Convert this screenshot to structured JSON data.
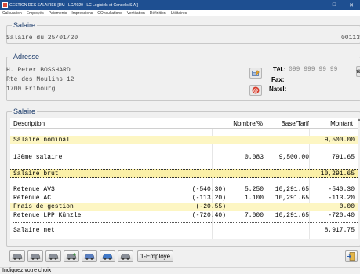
{
  "window": {
    "title": "GESTION DES SALAIRES [DM - LC/2020 - LC Logiciels et Conseils S.A.]",
    "min": "–",
    "max": "□",
    "close": "✕"
  },
  "menu": [
    "Calculation",
    "Employés",
    "Paiements",
    "Impressions",
    "COnsultations",
    "Ventilation",
    "Définition",
    "Utilitaires"
  ],
  "salaire_header": {
    "group_title": "Salaire",
    "date_text": "Salaire du 25/01/20",
    "number": "00113"
  },
  "adresse": {
    "group_title": "Adresse",
    "lines": [
      "H. Peter BOSSHARD",
      "Rte des Moulins 12",
      "1700 Fribourg"
    ],
    "tel_label": "Tél.:",
    "tel_value": "099 999 99 99",
    "fax_label": "Fax:",
    "natel_label": "Natel:"
  },
  "salaire": {
    "group_title": "Salaire",
    "columns": {
      "description": "Description",
      "nombre": "Nombre/%",
      "base": "Base/Tarif",
      "montant": "Montant"
    },
    "rows": {
      "nominal": {
        "desc": "Salaire nominal",
        "montant": "9,500.00"
      },
      "treizieme": {
        "desc": "13ème salaire",
        "nombre": "0.083",
        "base": "9,500.00",
        "montant": "791.65"
      },
      "brut": {
        "desc": "Salaire brut",
        "montant": "10,291.65"
      },
      "avs": {
        "desc": "Retenue AVS",
        "paren": "(-540.30)",
        "nombre": "5.250",
        "base": "10,291.65",
        "montant": "-540.30"
      },
      "ac": {
        "desc": "Retenue AC",
        "paren": "(-113.20)",
        "nombre": "1.100",
        "base": "10,291.65",
        "montant": "-113.20"
      },
      "frais": {
        "desc": "Frais de gestion",
        "paren": "(-20.55)",
        "montant": "0.00"
      },
      "lpp": {
        "desc": "Retenue LPP Künzle",
        "paren": "(-720.40)",
        "nombre": "7.000",
        "base": "10,291.65",
        "montant": "-720.40"
      },
      "net": {
        "desc": "Salaire net",
        "montant": "8,917.75"
      }
    }
  },
  "toolbar": {
    "employe_label": "1-Employé"
  },
  "icons": {
    "toolbar": [
      "car-icon",
      "car-icon",
      "car-icon",
      "car-add-icon",
      "car-edit-icon",
      "car-search-icon",
      "car-print-icon"
    ],
    "exit": "exit-door-icon"
  },
  "status": {
    "text": "Indiquez votre choix"
  },
  "colors": {
    "titlebar": "#1e4f91",
    "row_highlight": "#fdf6c3",
    "group_title": "#1a3a6a"
  }
}
